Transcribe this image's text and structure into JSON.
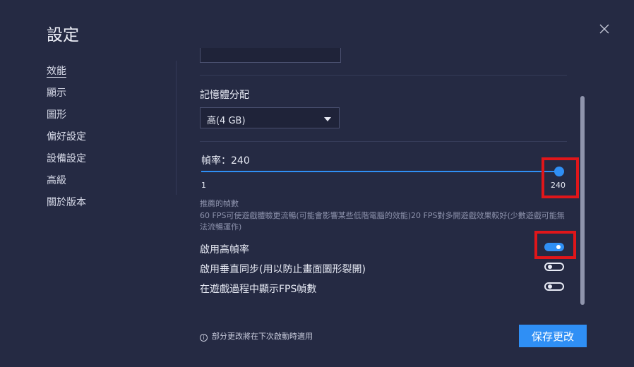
{
  "dialog": {
    "title": "設定"
  },
  "nav": {
    "items": [
      {
        "label": "效能",
        "active": true
      },
      {
        "label": "顯示"
      },
      {
        "label": "圖形"
      },
      {
        "label": "偏好設定"
      },
      {
        "label": "設備設定"
      },
      {
        "label": "高級"
      },
      {
        "label": "關於版本"
      }
    ]
  },
  "memory": {
    "label": "記憶體分配",
    "selected": "高(4 GB)"
  },
  "framerate": {
    "label": "幀率：240",
    "min_label": "1",
    "current_label": "240",
    "value": 240,
    "min": 1,
    "max": 240,
    "hint_title": "推薦的幀數",
    "hint_text": "60 FPS可使遊戲體驗更流暢(可能會影響某些低階電腦的效能)20 FPS對多開遊戲效果較好(少數遊戲可能無法流暢運作)"
  },
  "toggles": [
    {
      "label": "啟用高幀率",
      "on": true
    },
    {
      "label": "啟用垂直同步(用以防止畫面圖形裂開)",
      "on": false
    },
    {
      "label": "在遊戲過程中顯示FPS幀數",
      "on": false
    }
  ],
  "footer": {
    "note": "部分更改將在下次啟動時適用",
    "info_icon": "i",
    "save_label": "保存更改"
  },
  "colors": {
    "background": "#252a43",
    "accent": "#2f8ff5",
    "highlight": "#e0161a"
  }
}
